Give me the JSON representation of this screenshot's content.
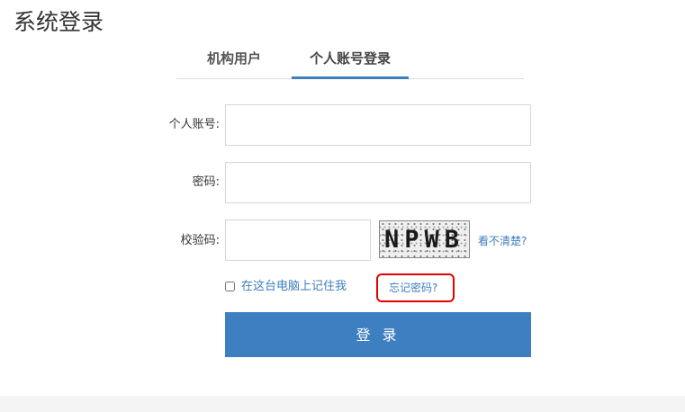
{
  "page": {
    "title": "系统登录"
  },
  "tabs": [
    {
      "label": "机构用户",
      "active": false
    },
    {
      "label": "个人账号登录",
      "active": true
    }
  ],
  "form": {
    "account_label": "个人账号:",
    "password_label": "密码:",
    "captcha_label": "校验码:",
    "account_value": "",
    "password_value": "",
    "captcha_value": "",
    "captcha_image_text": "NPWB",
    "captcha_refresh_label": "看不清楚?",
    "remember_label": "在这台电脑上记住我",
    "remember_checked": false,
    "forgot_password_label": "忘记密码?",
    "submit_label": "登 录"
  },
  "colors": {
    "accent": "#3d7fc1",
    "link": "#3d7ebf",
    "highlight": "#e60000"
  }
}
